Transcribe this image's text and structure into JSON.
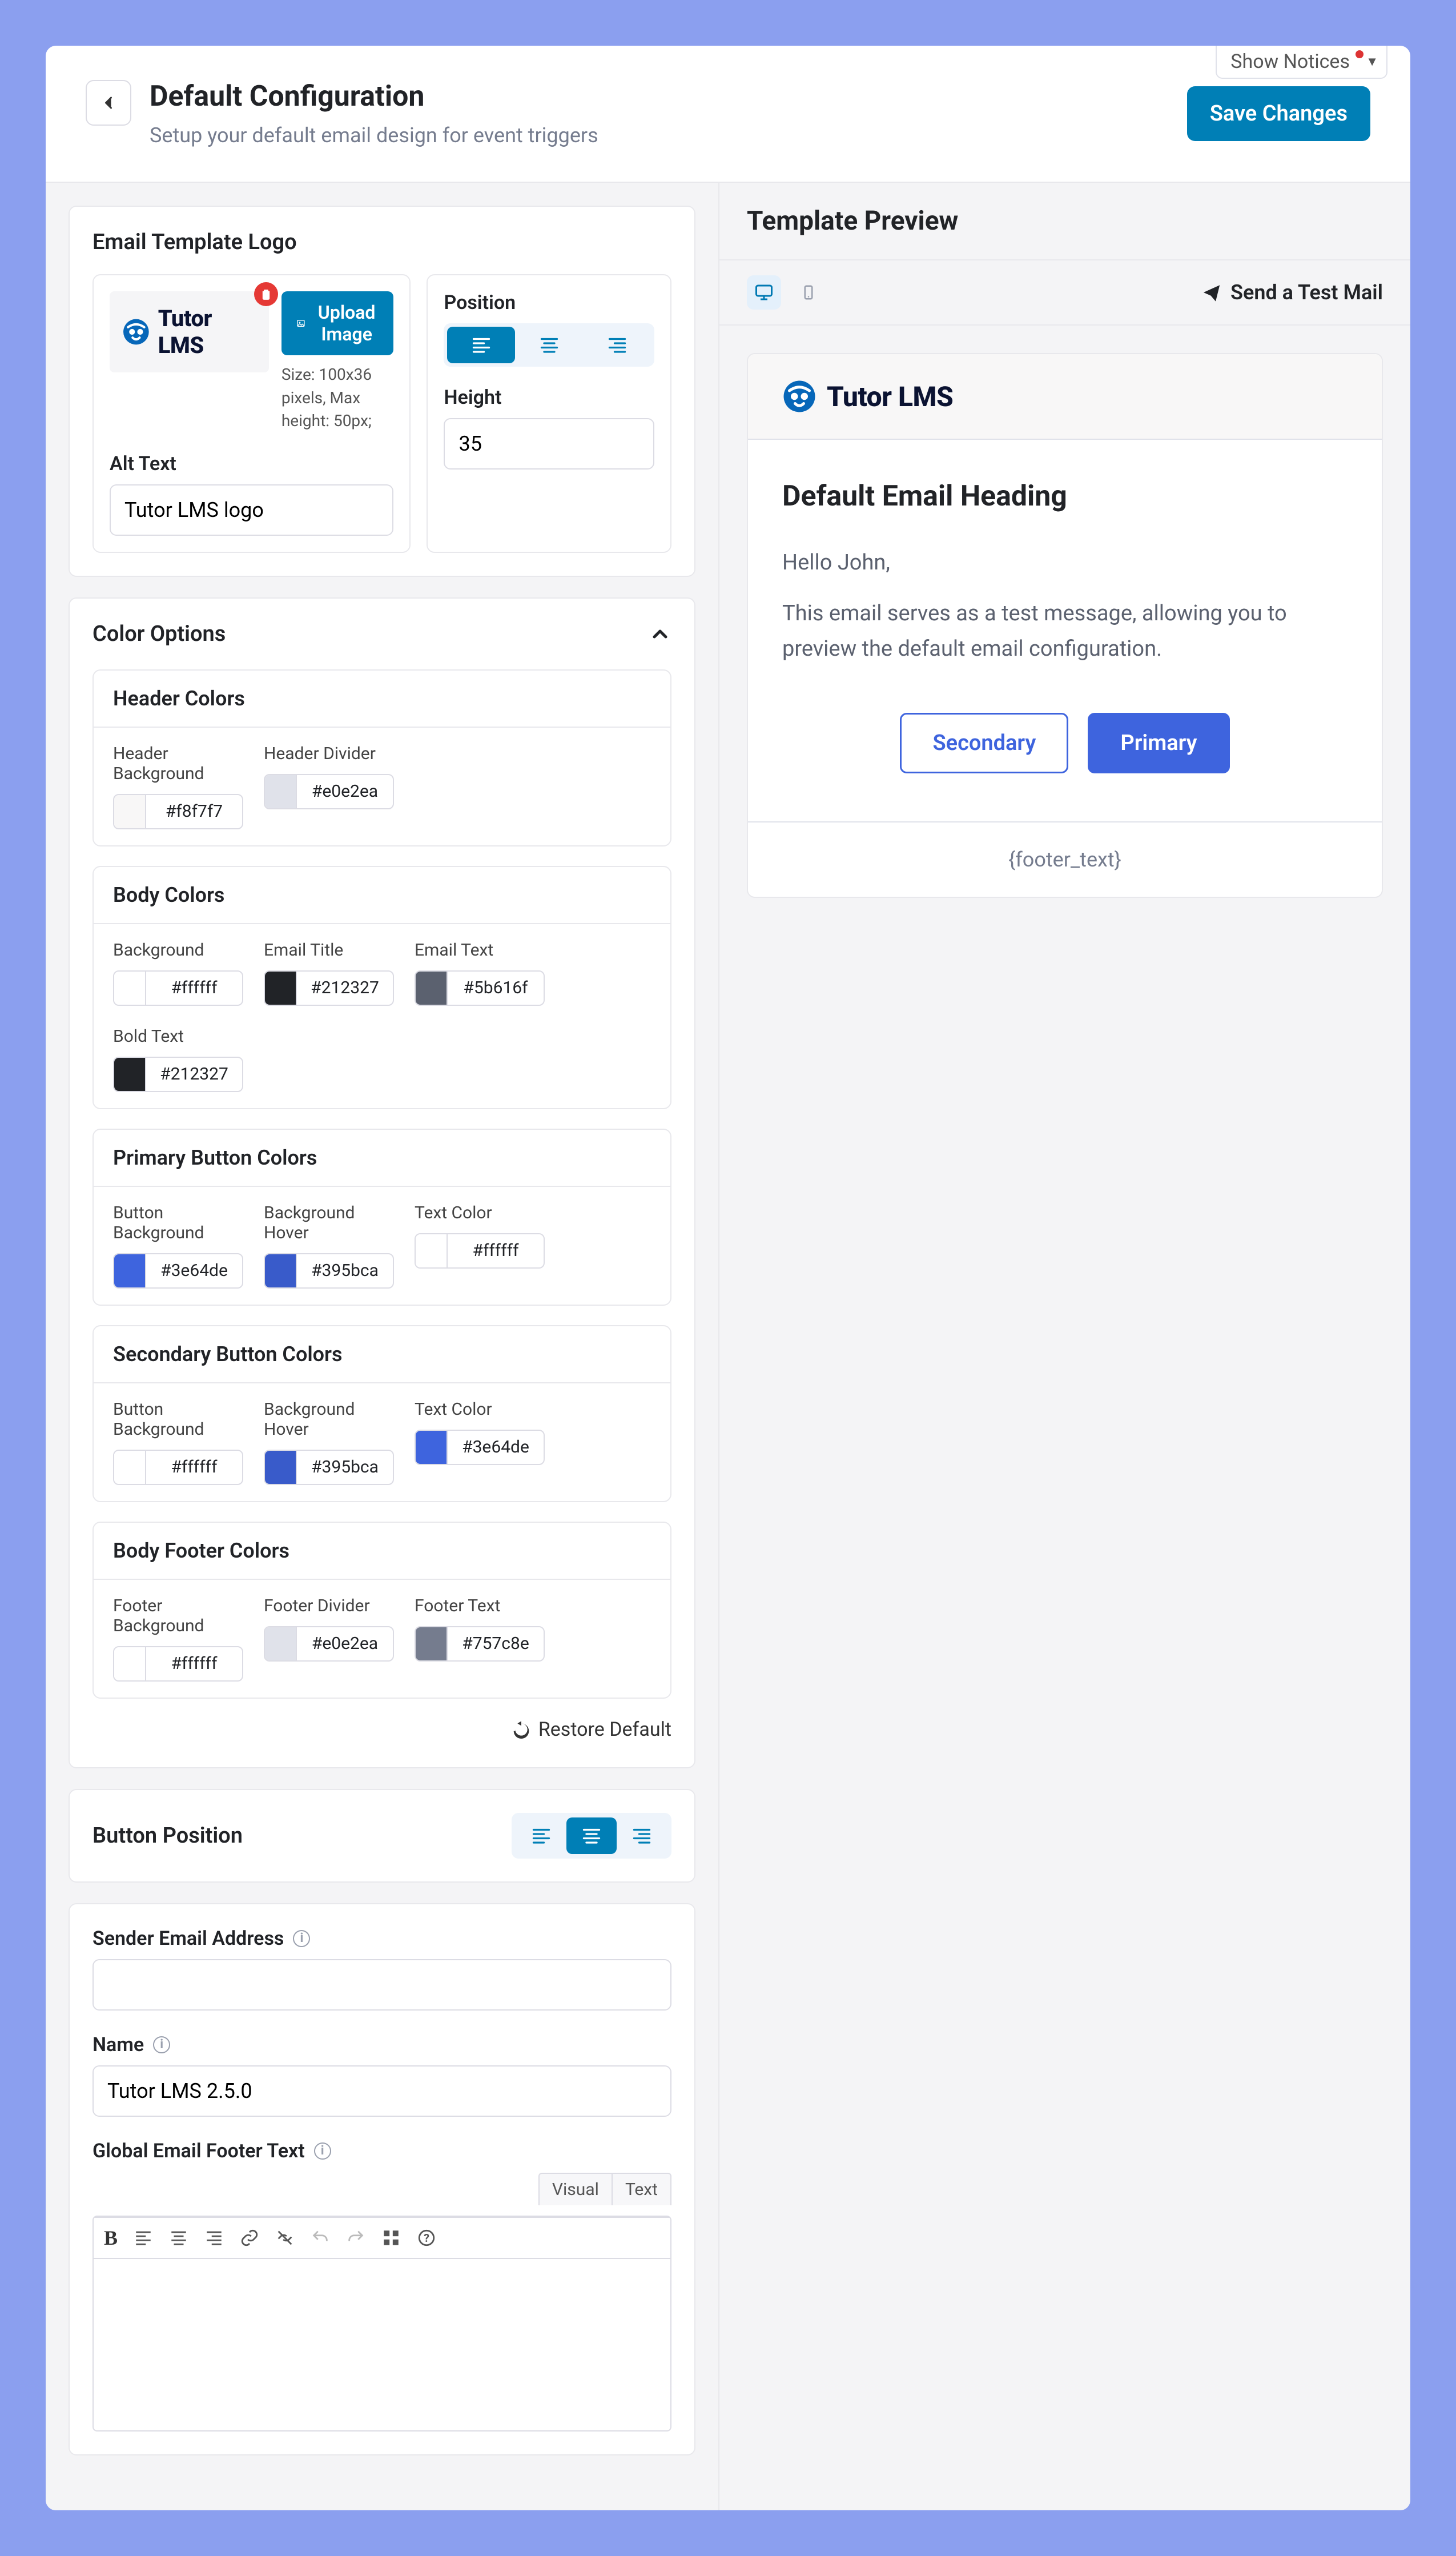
{
  "notices_label": "Show Notices",
  "header": {
    "title": "Default Configuration",
    "subtitle": "Setup your default email design for event triggers",
    "save_label": "Save Changes"
  },
  "logo_panel": {
    "title": "Email Template Logo",
    "brand_name": "Tutor LMS",
    "upload_label": "Upload Image",
    "size_hint": "Size: 100x36 pixels, Max height: 50px;",
    "alt_label": "Alt Text",
    "alt_value": "Tutor LMS logo",
    "position_label": "Position",
    "height_label": "Height",
    "height_value": "35"
  },
  "color_panel": {
    "title": "Color Options",
    "groups": [
      {
        "title": "Header Colors",
        "items": [
          {
            "label": "Header Background",
            "hex": "#f8f7f7"
          },
          {
            "label": "Header Divider",
            "hex": "#e0e2ea"
          }
        ]
      },
      {
        "title": "Body Colors",
        "items": [
          {
            "label": "Background",
            "hex": "#ffffff"
          },
          {
            "label": "Email Title",
            "hex": "#212327"
          },
          {
            "label": "Email Text",
            "hex": "#5b616f"
          },
          {
            "label": "Bold Text",
            "hex": "#212327"
          }
        ]
      },
      {
        "title": "Primary Button Colors",
        "items": [
          {
            "label": "Button Background",
            "hex": "#3e64de"
          },
          {
            "label": "Background Hover",
            "hex": "#395bca"
          },
          {
            "label": "Text Color",
            "hex": "#ffffff"
          }
        ]
      },
      {
        "title": "Secondary Button Colors",
        "items": [
          {
            "label": "Button Background",
            "hex": "#ffffff"
          },
          {
            "label": "Background Hover",
            "hex": "#395bca"
          },
          {
            "label": "Text Color",
            "hex": "#3e64de"
          }
        ]
      },
      {
        "title": "Body Footer Colors",
        "items": [
          {
            "label": "Footer Background",
            "hex": "#ffffff"
          },
          {
            "label": "Footer Divider",
            "hex": "#e0e2ea"
          },
          {
            "label": "Footer Text",
            "hex": "#757c8e"
          }
        ]
      }
    ],
    "restore_label": "Restore Default"
  },
  "button_position": {
    "title": "Button Position"
  },
  "sender": {
    "email_label": "Sender Email Address",
    "email_value": "",
    "name_label": "Name",
    "name_value": "Tutor LMS 2.5.0",
    "footer_label": "Global Email Footer Text",
    "tab_visual": "Visual",
    "tab_text": "Text"
  },
  "preview": {
    "title": "Template Preview",
    "send_test": "Send a Test Mail",
    "brand": "Tutor LMS",
    "heading": "Default Email Heading",
    "greeting": "Hello John,",
    "body": "This email serves as a test message, allowing you to preview the default email configuration.",
    "secondary_btn": "Secondary",
    "primary_btn": "Primary",
    "footer": "{footer_text}"
  }
}
